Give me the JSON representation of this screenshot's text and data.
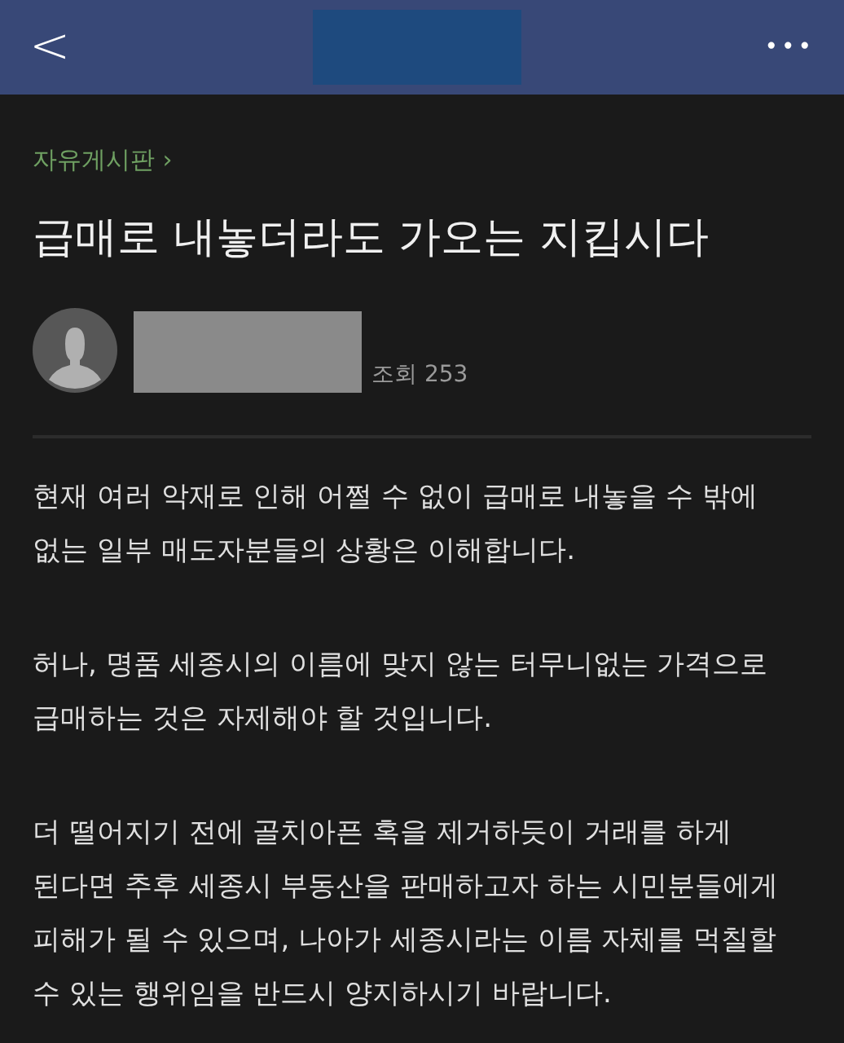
{
  "header": {
    "back_icon": "<",
    "menu_icon": "•••"
  },
  "post": {
    "board": "자유게시판 ›",
    "title": "급매로 내놓더라도 가오는 지킵시다",
    "views": "조회 253",
    "paragraphs": [
      "현재 여러 악재로 인해 어쩔 수 없이 급매로 내놓을 수 밖에 없는 일부 매도자분들의 상황은 이해합니다.",
      "허나, 명품 세종시의 이름에 맞지 않는 터무니없는 가격으로 급매하는 것은 자제해야 할 것입니다.",
      "더 떨어지기 전에 골치아픈 혹을 제거하듯이 거래를 하게 된다면 추후 세종시 부동산을 판매하고자 하는 시민분들에게 피해가 될 수 있으며, 나아가 세종시라는 이름 자체를 먹칠할 수 있는 행위임을 반드시 양지하시기 바랍니다."
    ]
  }
}
